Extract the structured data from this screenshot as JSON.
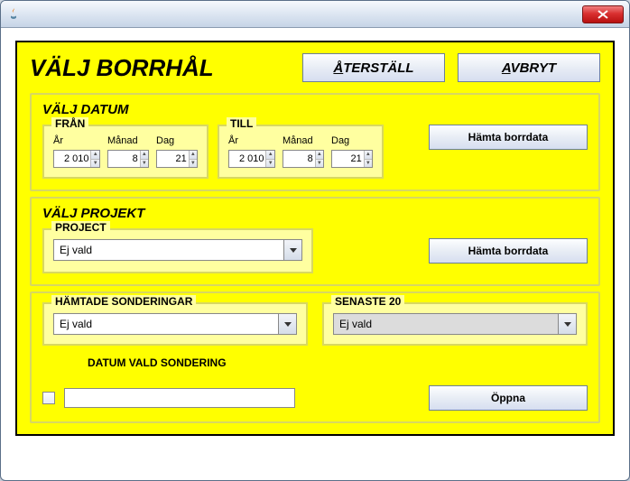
{
  "window": {
    "title": ""
  },
  "header": {
    "title": "VÄLJ BORRHÅL",
    "reset_label": "ÅTERSTÄLL",
    "cancel_label": "AVBRYT"
  },
  "date_section": {
    "title": "VÄLJ DATUM",
    "from": {
      "legend": "FRÅN",
      "year_label": "År",
      "month_label": "Månad",
      "day_label": "Dag",
      "year": "2 010",
      "month": "8",
      "day": "21"
    },
    "to": {
      "legend": "TILL",
      "year_label": "År",
      "month_label": "Månad",
      "day_label": "Dag",
      "year": "2 010",
      "month": "8",
      "day": "21"
    },
    "fetch_button": "Hämta borrdata"
  },
  "project_section": {
    "title": "VÄLJ PROJEKT",
    "project": {
      "legend": "PROJECT",
      "value": "Ej vald"
    },
    "fetch_button": "Hämta borrdata"
  },
  "sonder_section": {
    "fetched": {
      "legend": "HÄMTADE SONDERINGAR",
      "value": "Ej vald"
    },
    "latest": {
      "legend": "SENASTE 20",
      "value": "Ej vald"
    },
    "date_label": "DATUM VALD SONDERING",
    "date_value": "",
    "open_button": "Öppna"
  }
}
